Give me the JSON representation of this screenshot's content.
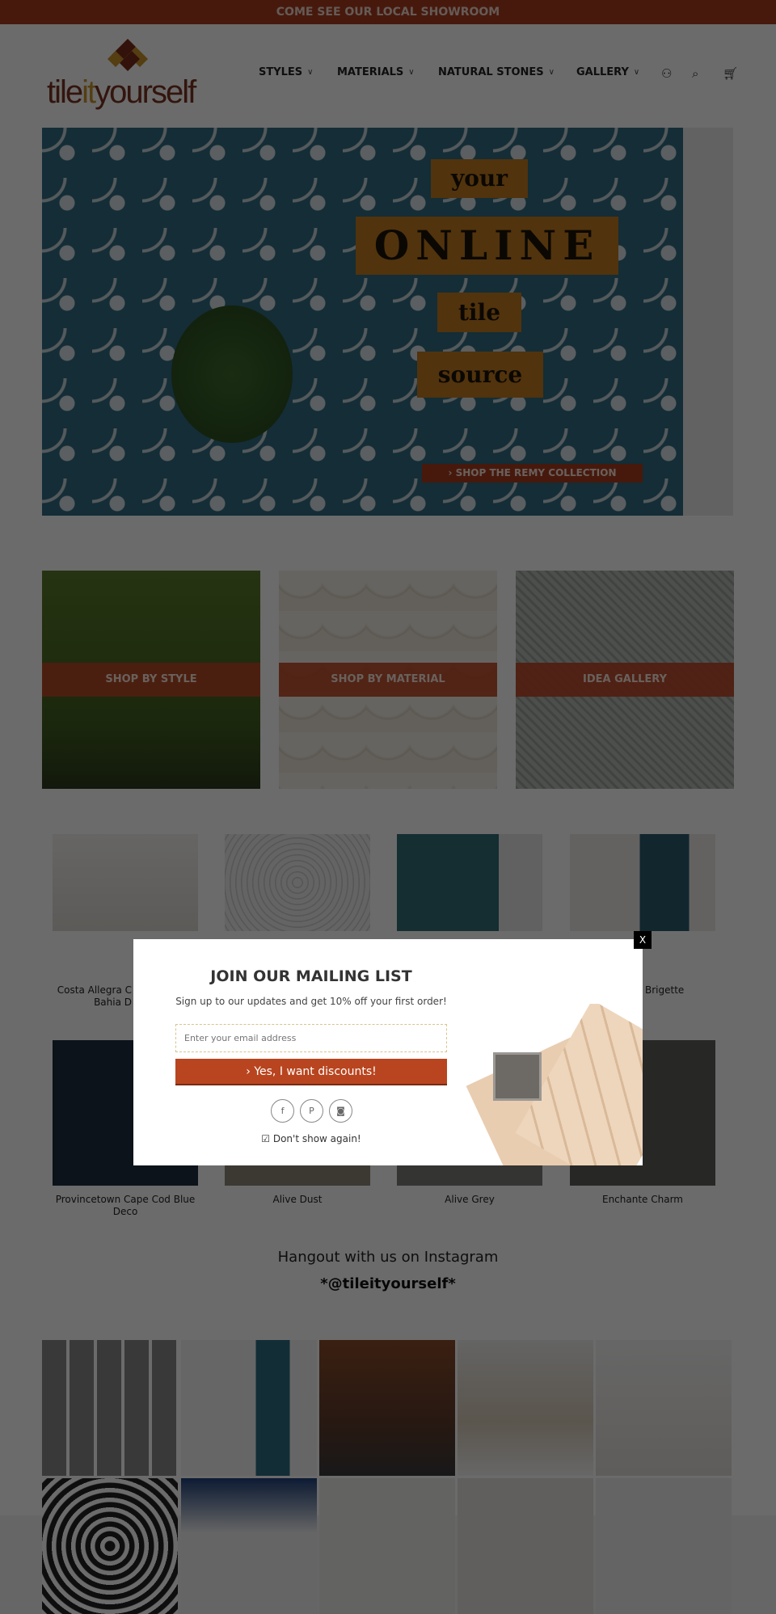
{
  "announcement": "COME SEE OUR LOCAL SHOWROOM",
  "logo": {
    "text_before": "tile",
    "text_accent": "it",
    "text_after": "yourself"
  },
  "nav": {
    "items": [
      {
        "label": "STYLES"
      },
      {
        "label": "MATERIALS"
      },
      {
        "label": "NATURAL STONES"
      },
      {
        "label": "GALLERY"
      }
    ],
    "icons": [
      "account-icon",
      "search-icon",
      "cart-icon"
    ]
  },
  "hero": {
    "words": [
      "your",
      "ONLINE",
      "tile",
      "source"
    ],
    "cta": "SHOP THE REMY COLLECTION"
  },
  "tiles": [
    {
      "label": "SHOP BY STYLE"
    },
    {
      "label": "SHOP BY MATERIAL"
    },
    {
      "label": "IDEA GALLERY"
    }
  ],
  "products": [
    {
      "line1": "Costa Allegra C",
      "line2": "Bahia D"
    },
    {
      "line1": "",
      "line2": ""
    },
    {
      "line1": "",
      "line2": ""
    },
    {
      "line1": "Brigette",
      "line2": ""
    },
    {
      "line1": "Provincetown Cape Cod Blue",
      "line2": "Deco"
    },
    {
      "line1": "Alive Dust",
      "line2": ""
    },
    {
      "line1": "Alive Grey",
      "line2": ""
    },
    {
      "line1": "Enchante Charm",
      "line2": ""
    }
  ],
  "instagram": {
    "title": "Hangout with us on Instagram",
    "handle": "*@tileityourself*"
  },
  "popup": {
    "close": "X",
    "title": "JOIN OUR MAILING LIST",
    "subtitle": "Sign up to our updates and get 10% off your first order!",
    "email_placeholder": "Enter your email address",
    "submit": "Yes,  I  want  discounts!",
    "social": [
      "f",
      "P",
      "◙"
    ],
    "dont_show": "Don't show again!",
    "dont_show_checked": true
  },
  "colors": {
    "brand": "#a83c20",
    "accent": "#c9932a",
    "button": "#b8451f"
  }
}
